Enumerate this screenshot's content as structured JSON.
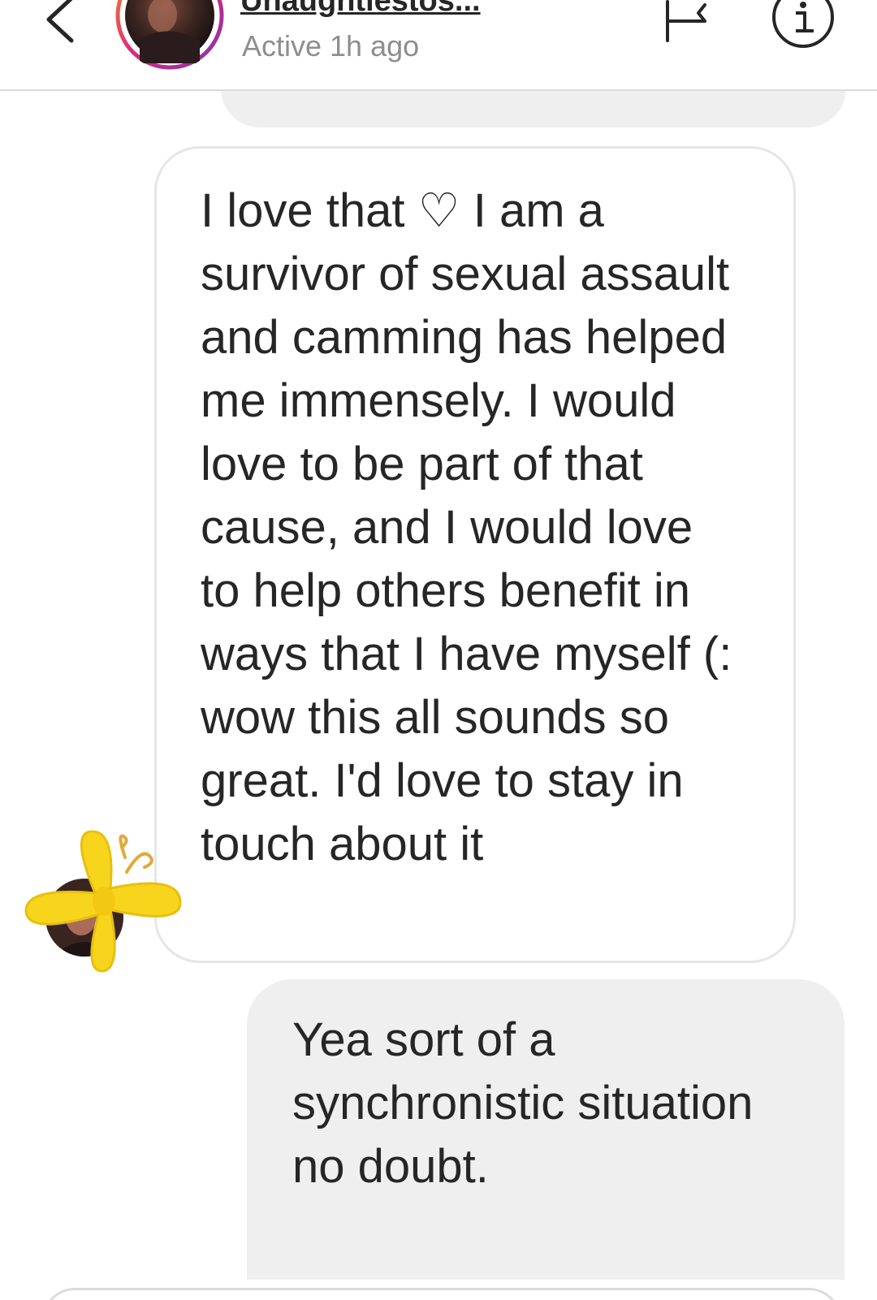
{
  "header": {
    "username": "Unaughtiestos...",
    "status": "Active 1h ago"
  },
  "conversation": {
    "messages": [
      {
        "direction": "incoming",
        "text": "I love that ♡ I am a\nsurvivor of sexual assault\nand camming has helped\nme immensely. I would\nlove to be part of that\ncause, and I would love\nto help others benefit in\nways that I have myself (:\nwow this all sounds so\ngreat. I'd love to stay in\ntouch about it"
      },
      {
        "direction": "outgoing",
        "text": "Yea sort of a\nsynchronistic situation\nno doubt."
      }
    ]
  },
  "icons": {
    "back": "chevron-left-icon",
    "flag": "flag-icon",
    "info": "info-icon",
    "sticker": "butterfly-icon"
  },
  "colors": {
    "text": "#262626",
    "secondary_text": "#8e8e8e",
    "bubble_gray": "#efefef",
    "bubble_border": "#e6e6e6",
    "sticker_yellow": "#f7d51d"
  }
}
